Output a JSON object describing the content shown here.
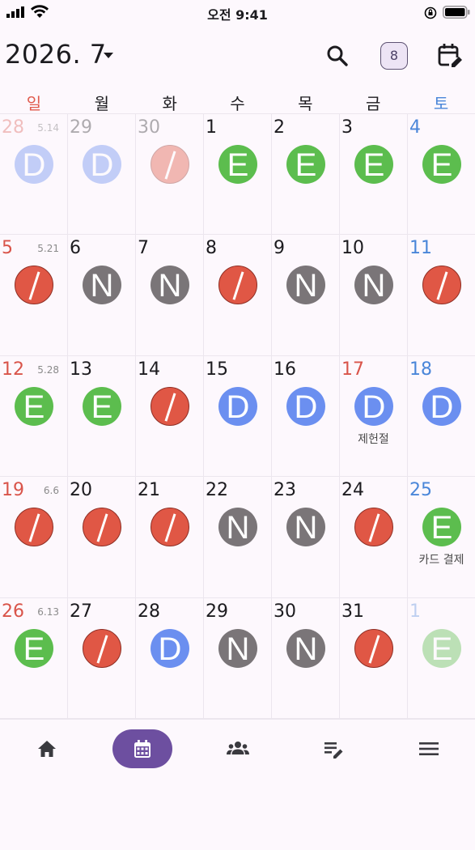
{
  "status_bar": {
    "time": "오전 9:41"
  },
  "header": {
    "month_title": "2026. 7",
    "badge_count": "8"
  },
  "weekdays": [
    "일",
    "월",
    "화",
    "수",
    "목",
    "금",
    "토"
  ],
  "weeks": [
    [
      {
        "day": "28",
        "lunar": "5.14",
        "shift": "D",
        "dim": true
      },
      {
        "day": "29",
        "shift": "D",
        "dim": true
      },
      {
        "day": "30",
        "shift": "/",
        "dim": true
      },
      {
        "day": "1",
        "shift": "E"
      },
      {
        "day": "2",
        "shift": "E"
      },
      {
        "day": "3",
        "shift": "E"
      },
      {
        "day": "4",
        "shift": "E"
      }
    ],
    [
      {
        "day": "5",
        "lunar": "5.21",
        "shift": "/"
      },
      {
        "day": "6",
        "shift": "N"
      },
      {
        "day": "7",
        "shift": "N"
      },
      {
        "day": "8",
        "shift": "/"
      },
      {
        "day": "9",
        "shift": "N"
      },
      {
        "day": "10",
        "shift": "N"
      },
      {
        "day": "11",
        "shift": "/"
      }
    ],
    [
      {
        "day": "12",
        "lunar": "5.28",
        "shift": "E"
      },
      {
        "day": "13",
        "shift": "E"
      },
      {
        "day": "14",
        "shift": "/"
      },
      {
        "day": "15",
        "shift": "D"
      },
      {
        "day": "16",
        "shift": "D"
      },
      {
        "day": "17",
        "shift": "D",
        "memo": "제헌절",
        "holiday": true
      },
      {
        "day": "18",
        "shift": "D"
      }
    ],
    [
      {
        "day": "19",
        "lunar": "6.6",
        "shift": "/"
      },
      {
        "day": "20",
        "shift": "/"
      },
      {
        "day": "21",
        "shift": "/"
      },
      {
        "day": "22",
        "shift": "N"
      },
      {
        "day": "23",
        "shift": "N"
      },
      {
        "day": "24",
        "shift": "/"
      },
      {
        "day": "25",
        "shift": "E",
        "memo": "카드 결제"
      }
    ],
    [
      {
        "day": "26",
        "lunar": "6.13",
        "shift": "E"
      },
      {
        "day": "27",
        "shift": "/"
      },
      {
        "day": "28",
        "shift": "D"
      },
      {
        "day": "29",
        "shift": "N"
      },
      {
        "day": "30",
        "shift": "N"
      },
      {
        "day": "31",
        "shift": "/"
      },
      {
        "day": "1",
        "shift": "E",
        "dim": true
      }
    ]
  ],
  "bottom_nav": [
    {
      "icon": "home-icon"
    },
    {
      "icon": "calendar-icon",
      "active": true
    },
    {
      "icon": "group-icon"
    },
    {
      "icon": "edit-note-icon"
    },
    {
      "icon": "menu-icon"
    }
  ],
  "colors": {
    "shift_E": "#5cbd4e",
    "shift_D": "#6b8ff0",
    "shift_N": "#7a7578",
    "shift_off": "#e05745",
    "sunday": "#d9544a",
    "saturday": "#4a86d9",
    "nav_active": "#6d4fa0"
  }
}
